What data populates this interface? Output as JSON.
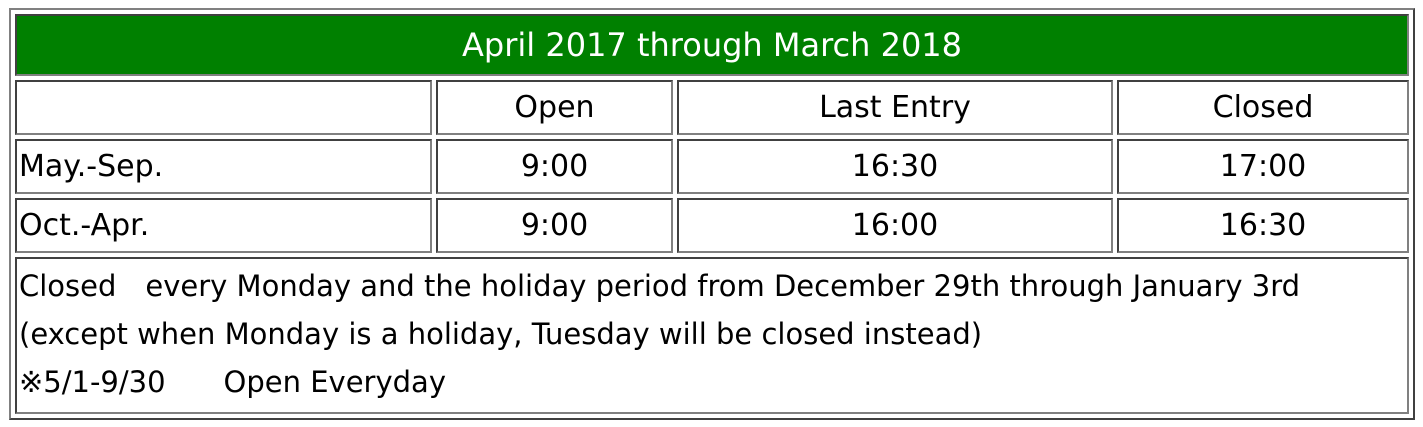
{
  "title": "April 2017 through March 2018",
  "columns": [
    "",
    "Open",
    "Last Entry",
    "Closed"
  ],
  "rows": [
    {
      "period": "May.-Sep.",
      "open": "9:00",
      "last_entry": "16:30",
      "closed": "17:00"
    },
    {
      "period": "Oct.-Apr.",
      "open": "9:00",
      "last_entry": "16:00",
      "closed": "16:30"
    }
  ],
  "notes": {
    "line1": "Closed　every Monday and the holiday period from December 29th through January 3rd",
    "line2": "(except when Monday is a holiday, Tuesday will be closed instead)",
    "line3": "※5/1-9/30　　Open Everyday"
  },
  "colors": {
    "title_background": "#008000",
    "title_text": "#ffffff"
  }
}
